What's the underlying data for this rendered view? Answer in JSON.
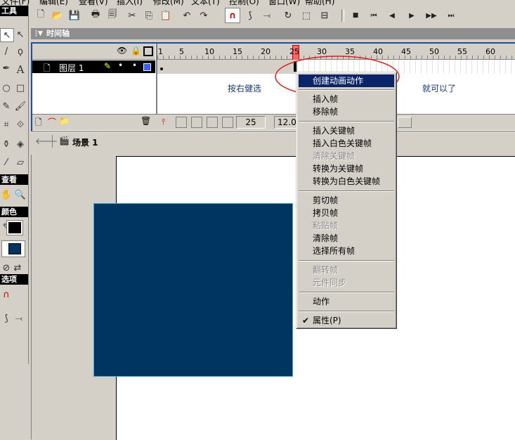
{
  "menubar": {
    "items": [
      "文件(F)",
      "编辑(E)",
      "查看(V)",
      "插入(I)",
      "修改(M)",
      "文本(T)",
      "控制(O)",
      "窗口(W)",
      "帮助(H)"
    ]
  },
  "tools_panel": {
    "title": "工具",
    "view_label": "查看",
    "colors_label": "颜色",
    "options_label": "选项"
  },
  "timeline": {
    "title": "时间轴",
    "layer_name": "图层 1",
    "ruler_numbers": [
      "1",
      "5",
      "10",
      "15",
      "20",
      "25",
      "30",
      "35",
      "40",
      "45",
      "50",
      "55",
      "60"
    ],
    "current_frame": "25",
    "frame_rate": "12.0",
    "hint_left": "按右健选",
    "hint_right": "就可以了"
  },
  "scene": {
    "name": "场景 1"
  },
  "context_menu": {
    "items": [
      {
        "label": "创建动画动作",
        "state": "highlighted"
      },
      {
        "label": "插入帧",
        "state": "enabled"
      },
      {
        "label": "移除帧",
        "state": "enabled"
      },
      {
        "label": "插入关键帧",
        "state": "enabled"
      },
      {
        "label": "插入白色关键帧",
        "state": "enabled"
      },
      {
        "label": "清除关键帧",
        "state": "disabled"
      },
      {
        "label": "转换为关键帧",
        "state": "enabled"
      },
      {
        "label": "转换为白色关键帧",
        "state": "enabled"
      },
      {
        "label": "剪切帧",
        "state": "enabled"
      },
      {
        "label": "拷贝帧",
        "state": "enabled"
      },
      {
        "label": "粘贴帧",
        "state": "disabled"
      },
      {
        "label": "清除帧",
        "state": "enabled"
      },
      {
        "label": "选择所有帧",
        "state": "enabled"
      },
      {
        "label": "翻转帧",
        "state": "disabled"
      },
      {
        "label": "元件同步",
        "state": "disabled"
      },
      {
        "label": "动作",
        "state": "enabled"
      },
      {
        "label": "属性(P)",
        "state": "checked"
      }
    ]
  },
  "colors": {
    "highlight": "#0a246a",
    "rectangle_fill": "#003461",
    "annotation": "#e02020",
    "playhead": "#ff6666"
  }
}
